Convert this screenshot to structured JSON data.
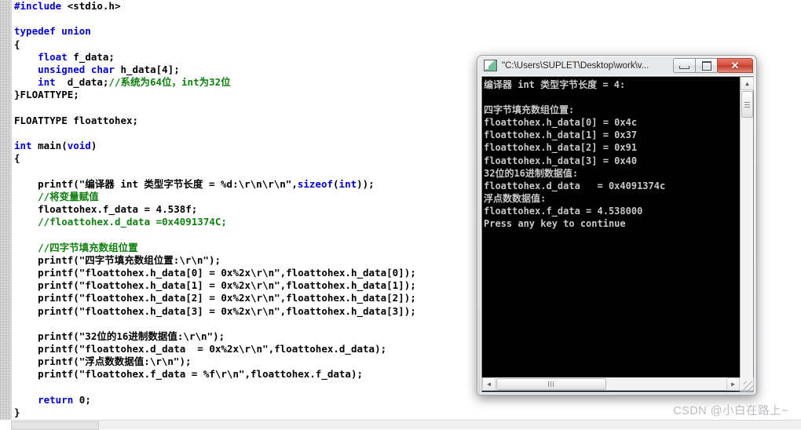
{
  "editor": {
    "name": "source-code-editor",
    "language": "c",
    "code_lines": [
      [
        {
          "t": "#include ",
          "c": "kw"
        },
        {
          "t": "<stdio.h>",
          "c": "pl"
        }
      ],
      [],
      [
        {
          "t": "typedef union",
          "c": "kw"
        }
      ],
      [
        {
          "t": "{",
          "c": "pl"
        }
      ],
      [
        {
          "t": "    ",
          "c": "pl"
        },
        {
          "t": "float",
          "c": "kw"
        },
        {
          "t": " f_data;",
          "c": "pl"
        }
      ],
      [
        {
          "t": "    ",
          "c": "pl"
        },
        {
          "t": "unsigned char",
          "c": "kw"
        },
        {
          "t": " h_data[4];",
          "c": "pl"
        }
      ],
      [
        {
          "t": "    ",
          "c": "pl"
        },
        {
          "t": "int",
          "c": "kw"
        },
        {
          "t": "  d_data;",
          "c": "pl"
        },
        {
          "t": "//系统为64位，int为32位",
          "c": "cm"
        }
      ],
      [
        {
          "t": "}FLOATTYPE;",
          "c": "pl"
        }
      ],
      [],
      [
        {
          "t": "FLOATTYPE floattohex;",
          "c": "pl"
        }
      ],
      [],
      [
        {
          "t": "int",
          "c": "kw"
        },
        {
          "t": " main(",
          "c": "pl"
        },
        {
          "t": "void",
          "c": "kw"
        },
        {
          "t": ")",
          "c": "pl"
        }
      ],
      [
        {
          "t": "{",
          "c": "pl"
        }
      ],
      [],
      [
        {
          "t": "    printf(\"编译器 int 类型字节长度 = %d:\\r\\n\\r\\n\",",
          "c": "pl"
        },
        {
          "t": "sizeof",
          "c": "kw"
        },
        {
          "t": "(",
          "c": "pl"
        },
        {
          "t": "int",
          "c": "kw"
        },
        {
          "t": "));",
          "c": "pl"
        }
      ],
      [
        {
          "t": "    ",
          "c": "pl"
        },
        {
          "t": "//将变量赋值",
          "c": "cm"
        }
      ],
      [
        {
          "t": "    floattohex.f_data = 4.538f;",
          "c": "pl"
        }
      ],
      [
        {
          "t": "    ",
          "c": "pl"
        },
        {
          "t": "//floattohex.d_data =0x4091374C;",
          "c": "cm"
        }
      ],
      [],
      [
        {
          "t": "    ",
          "c": "pl"
        },
        {
          "t": "//四字节填充数组位置",
          "c": "cm"
        }
      ],
      [
        {
          "t": "    printf(\"四字节填充数组位置:\\r\\n\");",
          "c": "pl"
        }
      ],
      [
        {
          "t": "    printf(\"floattohex.h_data[0] = 0x%2x\\r\\n\",floattohex.h_data[0]);",
          "c": "pl"
        }
      ],
      [
        {
          "t": "    printf(\"floattohex.h_data[1] = 0x%2x\\r\\n\",floattohex.h_data[1]);",
          "c": "pl"
        }
      ],
      [
        {
          "t": "    printf(\"floattohex.h_data[2] = 0x%2x\\r\\n\",floattohex.h_data[2]);",
          "c": "pl"
        }
      ],
      [
        {
          "t": "    printf(\"floattohex.h_data[3] = 0x%2x\\r\\n\",floattohex.h_data[3]);",
          "c": "pl"
        }
      ],
      [],
      [
        {
          "t": "    printf(\"32位的16进制数据值:\\r\\n\");",
          "c": "pl"
        }
      ],
      [
        {
          "t": "    printf(\"floattohex.d_data  = 0x%2x\\r\\n\",floattohex.d_data);",
          "c": "pl"
        }
      ],
      [
        {
          "t": "    printf(\"浮点数数据值:\\r\\n\");",
          "c": "pl"
        }
      ],
      [
        {
          "t": "    printf(\"floattohex.f_data = %f\\r\\n\",floattohex.f_data);",
          "c": "pl"
        }
      ],
      [],
      [
        {
          "t": "    ",
          "c": "pl"
        },
        {
          "t": "return",
          "c": "kw"
        },
        {
          "t": " 0;",
          "c": "pl"
        }
      ],
      [
        {
          "t": "}",
          "c": "pl"
        }
      ]
    ],
    "colors": {
      "keyword": "#0000d2",
      "comment": "#108010",
      "plain": "#000000",
      "background": "#ffffff"
    }
  },
  "console_window": {
    "title": "\"C:\\Users\\SUPLET\\Desktop\\work\\v...",
    "app_icon": "console-icon",
    "buttons": {
      "minimize": "minimize-button",
      "maximize": "maximize-button",
      "close_label": "✕"
    },
    "output_lines": [
      "编译器 int 类型字节长度 = 4:",
      "",
      "四字节填充数组位置:",
      "floattohex.h_data[0] = 0x4c",
      "floattohex.h_data[1] = 0x37",
      "floattohex.h_data[2] = 0x91",
      "floattohex.h_data[3] = 0x40",
      "32位的16进制数据值:",
      "floattohex.d_data   = 0x4091374c",
      "浮点数数据值:",
      "floattohex.f_data = 4.538000",
      "Press any key to continue"
    ],
    "scrollbars": {
      "vertical_up": "▲",
      "vertical_down": "▼",
      "horizontal_left": "◀",
      "horizontal_right": "▶"
    },
    "colors": {
      "background": "#000000",
      "text": "#c8c8c8",
      "close_button": "#c53b28"
    }
  },
  "watermark": {
    "text": "CSDN @小白在路上~"
  }
}
